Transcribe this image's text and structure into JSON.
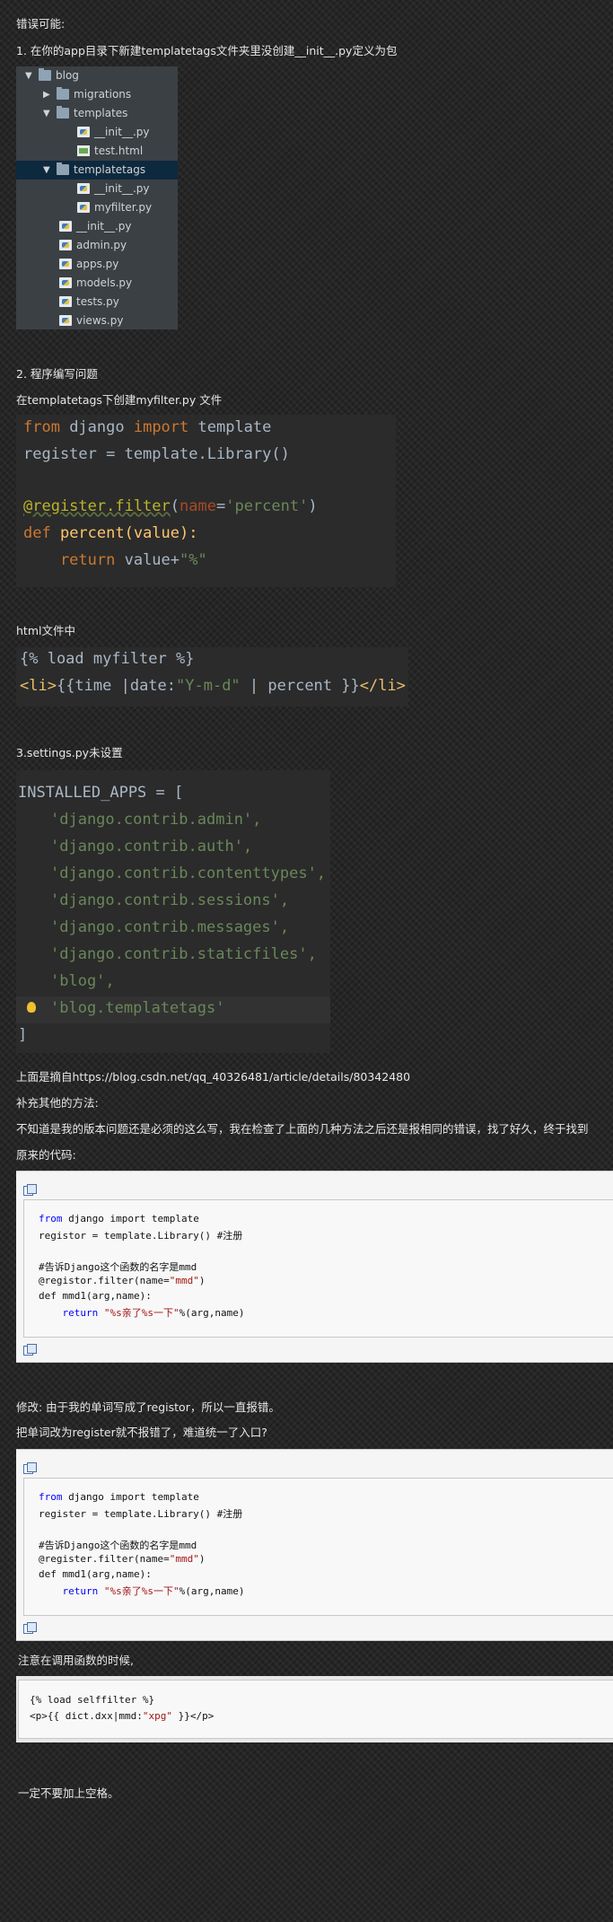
{
  "intro": {
    "title": "错误可能:",
    "step1": "1. 在你的app目录下新建templatetags文件夹里没创建__init__.py定义为包"
  },
  "tree": {
    "items": [
      {
        "label": "blog",
        "arrow": "▼",
        "icon": "folder-icon"
      },
      {
        "label": "migrations",
        "arrow": "▶",
        "icon": "folder-icon"
      },
      {
        "label": "templates",
        "arrow": "▼",
        "icon": "folder-icon"
      },
      {
        "label": "__init__.py",
        "arrow": "",
        "icon": "python-file-icon"
      },
      {
        "label": "test.html",
        "arrow": "",
        "icon": "html-file-icon"
      },
      {
        "label": "templatetags",
        "arrow": "▼",
        "icon": "folder-icon",
        "selected": true
      },
      {
        "label": "__init__.py",
        "arrow": "",
        "icon": "python-file-icon"
      },
      {
        "label": "myfilter.py",
        "arrow": "",
        "icon": "python-file-icon"
      },
      {
        "label": "__init__.py",
        "arrow": "",
        "icon": "python-file-icon"
      },
      {
        "label": "admin.py",
        "arrow": "",
        "icon": "python-file-icon"
      },
      {
        "label": "apps.py",
        "arrow": "",
        "icon": "python-file-icon"
      },
      {
        "label": "models.py",
        "arrow": "",
        "icon": "python-file-icon"
      },
      {
        "label": "tests.py",
        "arrow": "",
        "icon": "python-file-icon"
      },
      {
        "label": "views.py",
        "arrow": "",
        "icon": "python-file-icon"
      }
    ],
    "selected_color": "#0d293e"
  },
  "section2": {
    "title": "2. 程序编写问题",
    "desc": "在templatetags下创建myfilter.py 文件",
    "code": {
      "l1_from": "from",
      "l1_mod": " django ",
      "l1_import": "import",
      "l1_rest": " template",
      "l2": "register = template.Library()",
      "l3_dec": "@register.filter",
      "l3_open": "(",
      "l3_param": "name",
      "l3_eq": "=",
      "l3_str": "'percent'",
      "l3_close": ")",
      "l4_def": "def",
      "l4_rest": " percent(value):",
      "l5_ret": "    return",
      "l5_rest": " value+",
      "l5_str": "\"%\""
    }
  },
  "section_html": {
    "title": "html文件中",
    "line1": "{% load myfilter %}",
    "line2_open": "<li>",
    "line2_mid": "{{time |date:",
    "line2_str": "\"Y-m-d\"",
    "line2_rest": " | percent }}",
    "line2_close": "</li>"
  },
  "section3": {
    "title": "3.settings.py未设置",
    "head": "INSTALLED_APPS = [",
    "apps": [
      "'django.contrib.admin',",
      "'django.contrib.auth',",
      "'django.contrib.contenttypes',",
      "'django.contrib.sessions',",
      "'django.contrib.messages',",
      "'django.contrib.staticfiles',",
      "'blog',",
      "'blog.templatetags'"
    ],
    "tail": "]"
  },
  "source_line": "上面是摘自https://blog.csdn.net/qq_40326481/article/details/80342480",
  "supplement": {
    "title": "补充其他的方法:",
    "para": "不知道是我的版本问题还是必须的这么写，我在检查了上面的几种方法之后还是报相同的错误，找了好久，终于找到",
    "orig": "原来的代码:"
  },
  "code_a": {
    "l1_kw": "from",
    "l1_rest": " django import template",
    "l2": "registor = template.Library() #注册",
    "l3": "#告诉Django这个函数的名字是mmd",
    "l4_pre": "@registor.filter(name=",
    "l4_str": "\"mmd\"",
    "l4_post": ")",
    "l5": "def mmd1(arg,name):",
    "l6_kw": "    return",
    "l6_str": " \"%s亲了%s一下\"",
    "l6_post": "%(arg,name)"
  },
  "fix": {
    "line1": "修改: 由于我的单词写成了registor，所以一直报错。",
    "line2": "把单词改为register就不报错了，难道统一了入口?"
  },
  "code_b": {
    "l1_kw": "from",
    "l1_rest": " django import template",
    "l2": "register = template.Library() #注册",
    "l3": "#告诉Django这个函数的名字是mmd",
    "l4_pre": "@register.filter(name=",
    "l4_str": "\"mmd\"",
    "l4_post": ")",
    "l5": "def mmd1(arg,name):",
    "l6_kw": "    return",
    "l6_str": " \"%s亲了%s一下\"",
    "l6_post": "%(arg,name)"
  },
  "note": "注意在调用函数的时候,",
  "code_c": {
    "l1": "{% load selffilter %}",
    "l2_pre": "<p>{{ dict.dxx|mmd:",
    "l2_str": "\"xpg\"",
    "l2_post": " }}</p>"
  },
  "final": "一定不要加上空格。"
}
